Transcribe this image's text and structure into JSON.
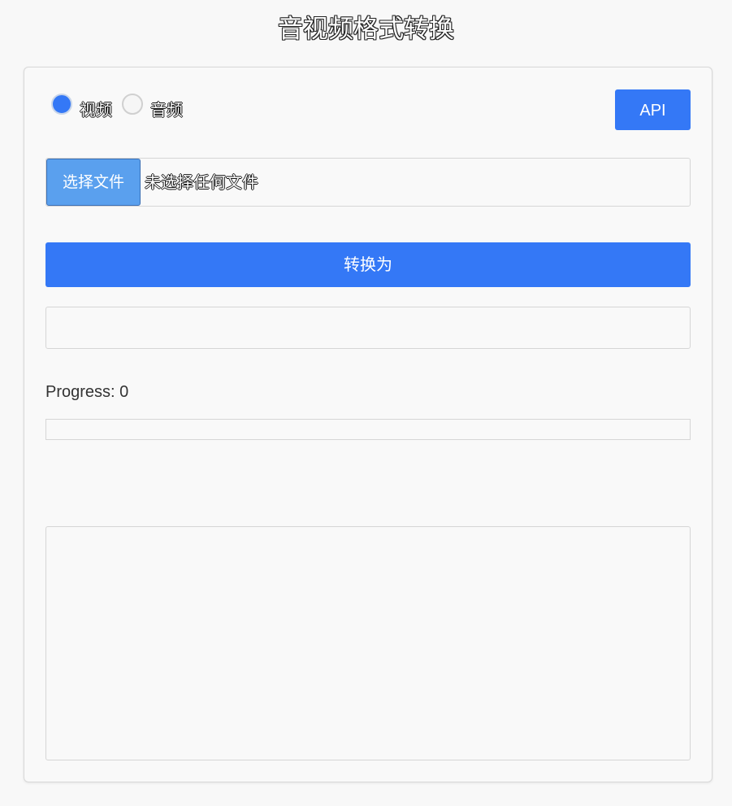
{
  "header": {
    "title": "音视频格式转换"
  },
  "media_type": {
    "options": [
      {
        "label": "视频",
        "checked": true
      },
      {
        "label": "音频",
        "checked": false
      }
    ]
  },
  "toolbar": {
    "api_label": "API"
  },
  "file_input": {
    "button_label": "选择文件",
    "status": "未选择任何文件"
  },
  "convert": {
    "button_label": "转换为"
  },
  "format_select": {
    "value": ""
  },
  "progress": {
    "text": "Progress: 0",
    "value": 0
  },
  "output": {
    "content": ""
  },
  "colors": {
    "accent": "#3478f6",
    "file_button": "#5aa0ee",
    "background": "#f8f8f8",
    "border": "#d6d6d6"
  }
}
